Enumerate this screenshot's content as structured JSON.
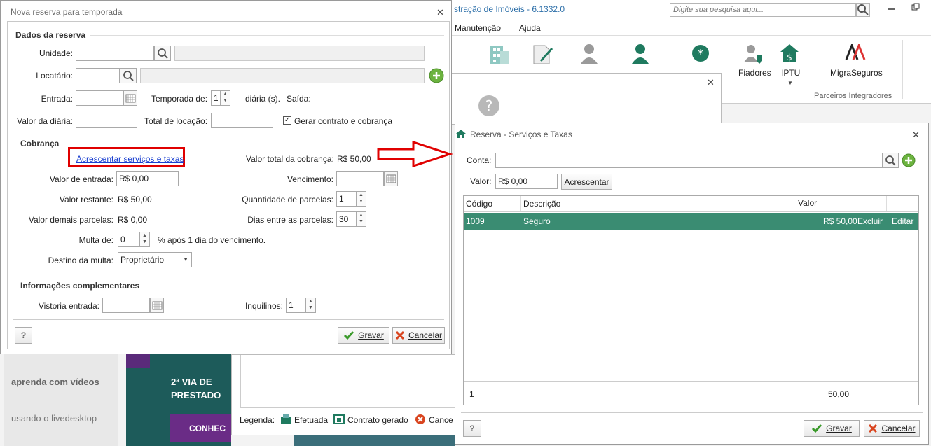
{
  "app": {
    "title_fragment": "stração de Imóveis - 6.1332.0",
    "search_placeholder": "Digite sua pesquisa aqui...",
    "menu": [
      "Manutenção",
      "Ajuda"
    ],
    "ribbon": {
      "fiadores": "Fiadores",
      "iptu": "IPTU",
      "migra": "MigraSeguros",
      "group_label": "Parceiros Integradores"
    },
    "bg_panel": {
      "ajuda_label": "Ajuda",
      "legend_label": "Legenda:",
      "legend_efetuada": "Efetuada",
      "legend_contrato": "Contrato gerado",
      "legend_cancel": "Cance"
    },
    "side": {
      "item1": "aprenda com vídeos",
      "item2": "usando o livedesktop"
    },
    "banner": {
      "line1": "2ª VIA DE",
      "line2": "PRESTADO",
      "cta": "CONHEC"
    }
  },
  "reserva": {
    "title": "Nova reserva para temporada",
    "sec_dados": "Dados da reserva",
    "lbl_unidade": "Unidade:",
    "lbl_locatario": "Locatário:",
    "lbl_entrada": "Entrada:",
    "lbl_temporada": "Temporada de:",
    "temporada_value": "1",
    "lbl_diarias": "diária (s).",
    "lbl_saida": "Saída:",
    "lbl_valor_diaria": "Valor da diária:",
    "lbl_total_locacao": "Total de locação:",
    "lbl_gerar_contrato": "Gerar contrato e cobrança",
    "gerar_checked": "✓",
    "sec_cobranca": "Cobrança",
    "link_acrescentar": "Acrescentar serviços e taxas",
    "lbl_valor_total": "Valor total da cobrança:",
    "valor_total": "R$ 50,00",
    "lbl_valor_entrada": "Valor de entrada:",
    "valor_entrada": "R$ 0,00",
    "lbl_vencimento": "Vencimento:",
    "lbl_valor_restante": "Valor restante:",
    "valor_restante": "R$ 50,00",
    "lbl_qtd_parcelas": "Quantidade de parcelas:",
    "qtd_parcelas": "1",
    "lbl_valor_demais": "Valor demais parcelas:",
    "valor_demais": "R$ 0,00",
    "lbl_dias_parcelas": "Dias entre as parcelas:",
    "dias_parcelas": "30",
    "lbl_multa": "Multa de:",
    "multa_value": "0",
    "lbl_multa_suffix": "% após 1 dia do vencimento.",
    "lbl_destino_multa": "Destino da multa:",
    "destino_multa": "Proprietário",
    "sec_info": "Informações complementares",
    "lbl_vistoria": "Vistoria entrada:",
    "lbl_inquilinos": "Inquilinos:",
    "inquilinos": "1",
    "help": "?",
    "btn_gravar": "Gravar",
    "btn_cancelar": "Cancelar"
  },
  "servicos": {
    "title": "Reserva - Serviços e Taxas",
    "lbl_conta": "Conta:",
    "lbl_valor": "Valor:",
    "valor": "R$ 0,00",
    "btn_acrescentar": "Acrescentar",
    "columns": [
      "Código",
      "Descrição",
      "Valor"
    ],
    "rows": [
      {
        "codigo": "1009",
        "descricao": "Seguro",
        "valor": "R$ 50,00",
        "excluir": "Excluir",
        "editar": "Editar"
      }
    ],
    "footer_count": "1",
    "footer_total": "50,00",
    "help": "?",
    "btn_gravar": "Gravar",
    "btn_cancelar": "Cancelar"
  },
  "colors": {
    "accent_green": "#1f7a5f",
    "row_selected": "#3a8c72",
    "highlight_red": "#e00000",
    "link_blue": "#1a3fd0"
  }
}
